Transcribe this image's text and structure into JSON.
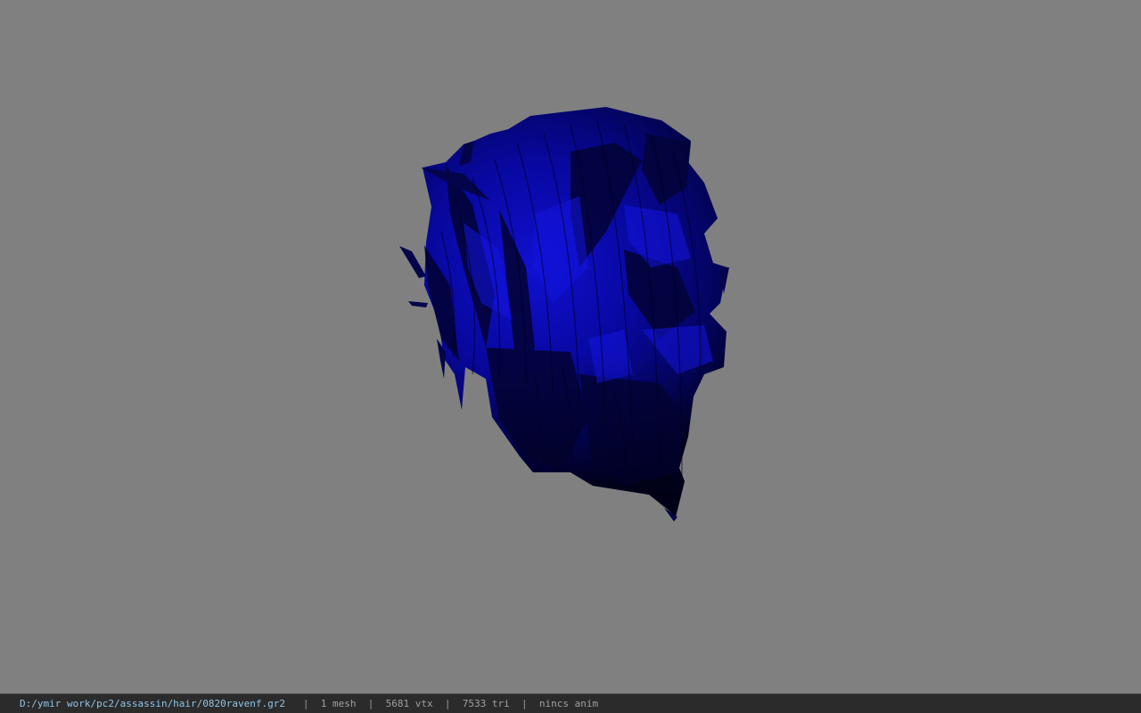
{
  "viewer": {
    "background_color": "#808080",
    "model_color": "#0000c8",
    "model_shadow_color": "#000010"
  },
  "statusbar": {
    "path": "D:/ymir work/pc2/assassin/hair/0820ravenf.gr2",
    "separator": "|",
    "mesh_count": "1 mesh",
    "vertex_count": "5681 vtx",
    "triangle_count": "7533 tri",
    "anim_status": "nincs anim",
    "path_color": "#8fc4e6",
    "text_color": "#9a9a9a",
    "bar_color": "#2b2b2b"
  }
}
